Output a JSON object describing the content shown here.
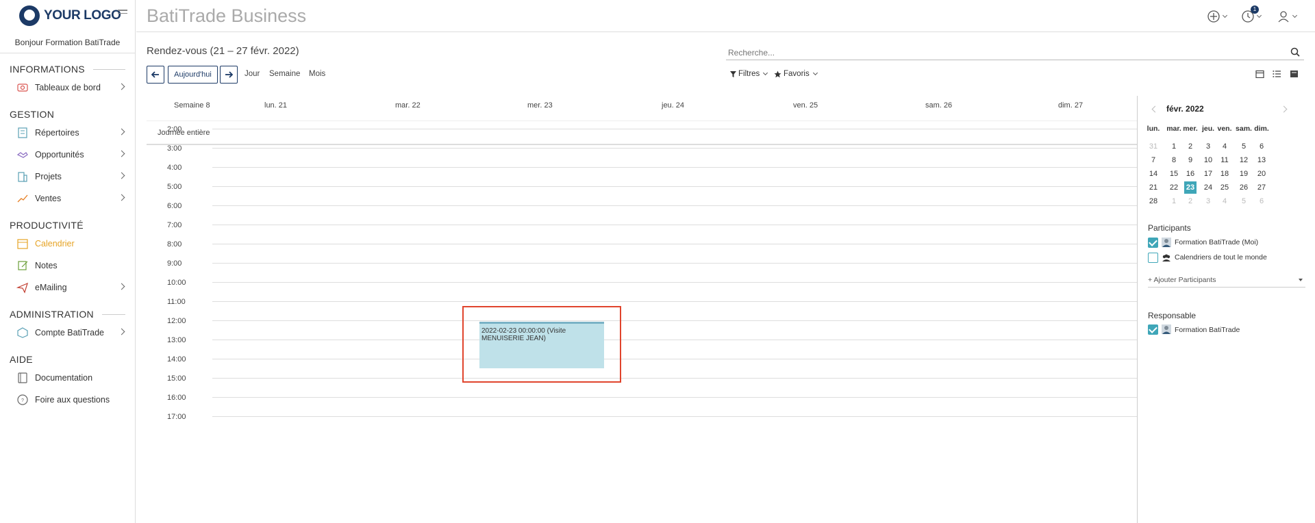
{
  "logo": {
    "text": "YOUR LOGO"
  },
  "app": {
    "title": "BatiTrade Business"
  },
  "topbar": {
    "notification_count": "1"
  },
  "sidebar": {
    "greeting": "Bonjour Formation BatiTrade",
    "sections": {
      "informations": "INFORMATIONS",
      "gestion": "GESTION",
      "productivite": "PRODUCTIVITÉ",
      "administration": "ADMINISTRATION",
      "aide": "AIDE"
    },
    "items": {
      "tableaux": "Tableaux de bord",
      "repertoires": "Répertoires",
      "opportunites": "Opportunités",
      "projets": "Projets",
      "ventes": "Ventes",
      "calendrier": "Calendrier",
      "notes": "Notes",
      "emailing": "eMailing",
      "compte": "Compte BatiTrade",
      "documentation": "Documentation",
      "faq": "Foire aux questions"
    }
  },
  "header": {
    "heading": "Rendez-vous (21 – 27 févr. 2022)",
    "search_placeholder": "Recherche...",
    "today": "Aujourd'hui",
    "views": {
      "day": "Jour",
      "week": "Semaine",
      "month": "Mois"
    },
    "filters": "Filtres",
    "favorites": "Favoris"
  },
  "calendar": {
    "week_label": "Semaine 8",
    "days": [
      "lun. 21",
      "mar. 22",
      "mer. 23",
      "jeu. 24",
      "ven. 25",
      "sam. 26",
      "dim. 27"
    ],
    "all_day": "Journée entière",
    "hours": [
      "2:00",
      "3:00",
      "4:00",
      "5:00",
      "6:00",
      "7:00",
      "8:00",
      "9:00",
      "10:00",
      "11:00",
      "12:00",
      "13:00",
      "14:00",
      "15:00",
      "16:00",
      "17:00"
    ],
    "event": {
      "text": "2022-02-23 00:00:00 (Visite MENUISERIE JEAN)"
    }
  },
  "mini_calendar": {
    "title": "févr. 2022",
    "dow": [
      "lun.",
      "mar.",
      "mer.",
      "jeu.",
      "ven.",
      "sam.",
      "dim."
    ],
    "weeks": [
      [
        "31",
        "1",
        "2",
        "3",
        "4",
        "5",
        "6"
      ],
      [
        "7",
        "8",
        "9",
        "10",
        "11",
        "12",
        "13"
      ],
      [
        "14",
        "15",
        "16",
        "17",
        "18",
        "19",
        "20"
      ],
      [
        "21",
        "22",
        "23",
        "24",
        "25",
        "26",
        "27"
      ],
      [
        "28",
        "1",
        "2",
        "3",
        "4",
        "5",
        "6"
      ]
    ],
    "today": "23"
  },
  "participants": {
    "heading": "Participants",
    "me": "Formation BatiTrade (Moi)",
    "everyone": "Calendriers de tout le monde",
    "add": "+ Ajouter Participants"
  },
  "responsable": {
    "heading": "Responsable",
    "name": "Formation BatiTrade"
  },
  "colors": {
    "accent": "#3fa6b8",
    "brand": "#1c3a66",
    "active": "#e6a324",
    "event": "#bfe1e9",
    "highlight": "#e0442c"
  }
}
